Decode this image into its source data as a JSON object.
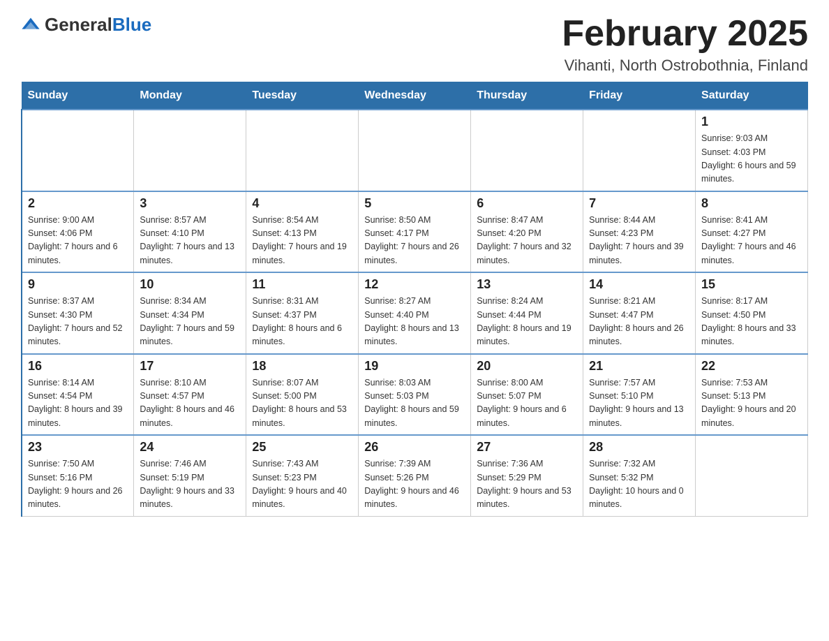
{
  "logo": {
    "text_general": "General",
    "text_blue": "Blue",
    "aria": "GeneralBlue logo"
  },
  "title": "February 2025",
  "subtitle": "Vihanti, North Ostrobothnia, Finland",
  "days_of_week": [
    "Sunday",
    "Monday",
    "Tuesday",
    "Wednesday",
    "Thursday",
    "Friday",
    "Saturday"
  ],
  "weeks": [
    [
      {
        "day": "",
        "info": ""
      },
      {
        "day": "",
        "info": ""
      },
      {
        "day": "",
        "info": ""
      },
      {
        "day": "",
        "info": ""
      },
      {
        "day": "",
        "info": ""
      },
      {
        "day": "",
        "info": ""
      },
      {
        "day": "1",
        "info": "Sunrise: 9:03 AM\nSunset: 4:03 PM\nDaylight: 6 hours and 59 minutes."
      }
    ],
    [
      {
        "day": "2",
        "info": "Sunrise: 9:00 AM\nSunset: 4:06 PM\nDaylight: 7 hours and 6 minutes."
      },
      {
        "day": "3",
        "info": "Sunrise: 8:57 AM\nSunset: 4:10 PM\nDaylight: 7 hours and 13 minutes."
      },
      {
        "day": "4",
        "info": "Sunrise: 8:54 AM\nSunset: 4:13 PM\nDaylight: 7 hours and 19 minutes."
      },
      {
        "day": "5",
        "info": "Sunrise: 8:50 AM\nSunset: 4:17 PM\nDaylight: 7 hours and 26 minutes."
      },
      {
        "day": "6",
        "info": "Sunrise: 8:47 AM\nSunset: 4:20 PM\nDaylight: 7 hours and 32 minutes."
      },
      {
        "day": "7",
        "info": "Sunrise: 8:44 AM\nSunset: 4:23 PM\nDaylight: 7 hours and 39 minutes."
      },
      {
        "day": "8",
        "info": "Sunrise: 8:41 AM\nSunset: 4:27 PM\nDaylight: 7 hours and 46 minutes."
      }
    ],
    [
      {
        "day": "9",
        "info": "Sunrise: 8:37 AM\nSunset: 4:30 PM\nDaylight: 7 hours and 52 minutes."
      },
      {
        "day": "10",
        "info": "Sunrise: 8:34 AM\nSunset: 4:34 PM\nDaylight: 7 hours and 59 minutes."
      },
      {
        "day": "11",
        "info": "Sunrise: 8:31 AM\nSunset: 4:37 PM\nDaylight: 8 hours and 6 minutes."
      },
      {
        "day": "12",
        "info": "Sunrise: 8:27 AM\nSunset: 4:40 PM\nDaylight: 8 hours and 13 minutes."
      },
      {
        "day": "13",
        "info": "Sunrise: 8:24 AM\nSunset: 4:44 PM\nDaylight: 8 hours and 19 minutes."
      },
      {
        "day": "14",
        "info": "Sunrise: 8:21 AM\nSunset: 4:47 PM\nDaylight: 8 hours and 26 minutes."
      },
      {
        "day": "15",
        "info": "Sunrise: 8:17 AM\nSunset: 4:50 PM\nDaylight: 8 hours and 33 minutes."
      }
    ],
    [
      {
        "day": "16",
        "info": "Sunrise: 8:14 AM\nSunset: 4:54 PM\nDaylight: 8 hours and 39 minutes."
      },
      {
        "day": "17",
        "info": "Sunrise: 8:10 AM\nSunset: 4:57 PM\nDaylight: 8 hours and 46 minutes."
      },
      {
        "day": "18",
        "info": "Sunrise: 8:07 AM\nSunset: 5:00 PM\nDaylight: 8 hours and 53 minutes."
      },
      {
        "day": "19",
        "info": "Sunrise: 8:03 AM\nSunset: 5:03 PM\nDaylight: 8 hours and 59 minutes."
      },
      {
        "day": "20",
        "info": "Sunrise: 8:00 AM\nSunset: 5:07 PM\nDaylight: 9 hours and 6 minutes."
      },
      {
        "day": "21",
        "info": "Sunrise: 7:57 AM\nSunset: 5:10 PM\nDaylight: 9 hours and 13 minutes."
      },
      {
        "day": "22",
        "info": "Sunrise: 7:53 AM\nSunset: 5:13 PM\nDaylight: 9 hours and 20 minutes."
      }
    ],
    [
      {
        "day": "23",
        "info": "Sunrise: 7:50 AM\nSunset: 5:16 PM\nDaylight: 9 hours and 26 minutes."
      },
      {
        "day": "24",
        "info": "Sunrise: 7:46 AM\nSunset: 5:19 PM\nDaylight: 9 hours and 33 minutes."
      },
      {
        "day": "25",
        "info": "Sunrise: 7:43 AM\nSunset: 5:23 PM\nDaylight: 9 hours and 40 minutes."
      },
      {
        "day": "26",
        "info": "Sunrise: 7:39 AM\nSunset: 5:26 PM\nDaylight: 9 hours and 46 minutes."
      },
      {
        "day": "27",
        "info": "Sunrise: 7:36 AM\nSunset: 5:29 PM\nDaylight: 9 hours and 53 minutes."
      },
      {
        "day": "28",
        "info": "Sunrise: 7:32 AM\nSunset: 5:32 PM\nDaylight: 10 hours and 0 minutes."
      },
      {
        "day": "",
        "info": ""
      }
    ]
  ]
}
